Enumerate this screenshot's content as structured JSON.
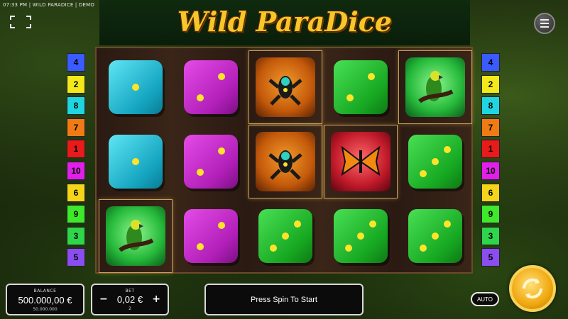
{
  "status_bar": {
    "time": "07:33 PM",
    "game_name": "WILD PARADICE",
    "mode": "DEMO"
  },
  "title": "Wild ParaDice",
  "paylines": {
    "left": [
      {
        "num": "4",
        "color": "#3a5bff"
      },
      {
        "num": "2",
        "color": "#f2e81a"
      },
      {
        "num": "8",
        "color": "#1fd6e0"
      },
      {
        "num": "7",
        "color": "#f07a14"
      },
      {
        "num": "1",
        "color": "#e81a1a"
      },
      {
        "num": "10",
        "color": "#e01fe8"
      },
      {
        "num": "6",
        "color": "#f4d51a"
      },
      {
        "num": "9",
        "color": "#3ee82a"
      },
      {
        "num": "3",
        "color": "#2ed64a"
      },
      {
        "num": "5",
        "color": "#8a4df0"
      }
    ],
    "right": [
      {
        "num": "4",
        "color": "#3a5bff"
      },
      {
        "num": "2",
        "color": "#f2e81a"
      },
      {
        "num": "8",
        "color": "#1fd6e0"
      },
      {
        "num": "7",
        "color": "#f07a14"
      },
      {
        "num": "1",
        "color": "#e81a1a"
      },
      {
        "num": "10",
        "color": "#e01fe8"
      },
      {
        "num": "6",
        "color": "#f4d51a"
      },
      {
        "num": "9",
        "color": "#3ee82a"
      },
      {
        "num": "3",
        "color": "#2ed64a"
      },
      {
        "num": "5",
        "color": "#8a4df0"
      }
    ]
  },
  "reels": [
    [
      "cyan-die-1",
      "magenta-die-2",
      "frog",
      "green-die-2",
      "parrot"
    ],
    [
      "cyan-die-1",
      "magenta-die-2",
      "frog",
      "butterfly",
      "green-die-3"
    ],
    [
      "parrot",
      "magenta-die-2",
      "green-die-3",
      "green-die-3",
      "green-die-3"
    ]
  ],
  "balance": {
    "label": "BALANCE",
    "value": "500.000,00 €",
    "sub": "50.000.000"
  },
  "bet": {
    "label": "BET",
    "value": "0,02 €",
    "sub": "2",
    "minus": "−",
    "plus": "+"
  },
  "message": "Press Spin To Start",
  "auto_label": "AUTO",
  "colors": {
    "title_gold": "#f7c628",
    "spin_gold": "#f0a80f"
  }
}
